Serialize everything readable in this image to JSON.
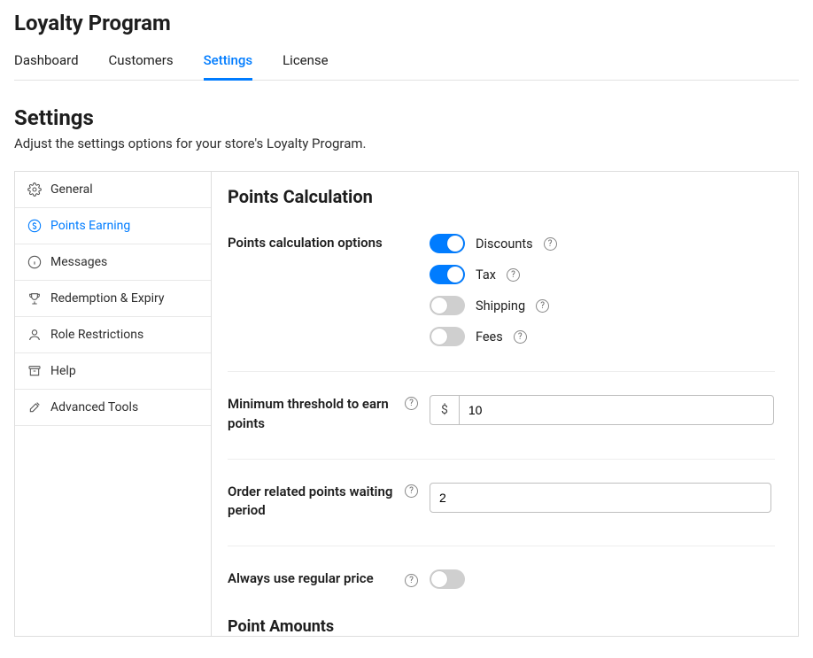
{
  "header": {
    "title": "Loyalty Program"
  },
  "tabs": {
    "items": [
      {
        "label": "Dashboard"
      },
      {
        "label": "Customers"
      },
      {
        "label": "Settings"
      },
      {
        "label": "License"
      }
    ],
    "active": 2
  },
  "section": {
    "title": "Settings",
    "subtitle": "Adjust the settings options for your store's Loyalty Program."
  },
  "sidebar": {
    "items": [
      {
        "label": "General"
      },
      {
        "label": "Points Earning"
      },
      {
        "label": "Messages"
      },
      {
        "label": "Redemption & Expiry"
      },
      {
        "label": "Role Restrictions"
      },
      {
        "label": "Help"
      },
      {
        "label": "Advanced Tools"
      }
    ],
    "active": 1
  },
  "card": {
    "points_calc_title": "Points Calculation",
    "calc_options_label": "Points calculation options",
    "toggles": {
      "discounts": {
        "label": "Discounts",
        "on": true
      },
      "tax": {
        "label": "Tax",
        "on": true
      },
      "shipping": {
        "label": "Shipping",
        "on": false
      },
      "fees": {
        "label": "Fees",
        "on": false
      }
    },
    "min_threshold": {
      "label": "Minimum threshold to earn points",
      "prefix": "$",
      "value": "10"
    },
    "waiting_period": {
      "label": "Order related points waiting period",
      "value": "2"
    },
    "regular_price": {
      "label": "Always use regular price",
      "on": false
    },
    "point_amounts_title": "Point Amounts"
  }
}
